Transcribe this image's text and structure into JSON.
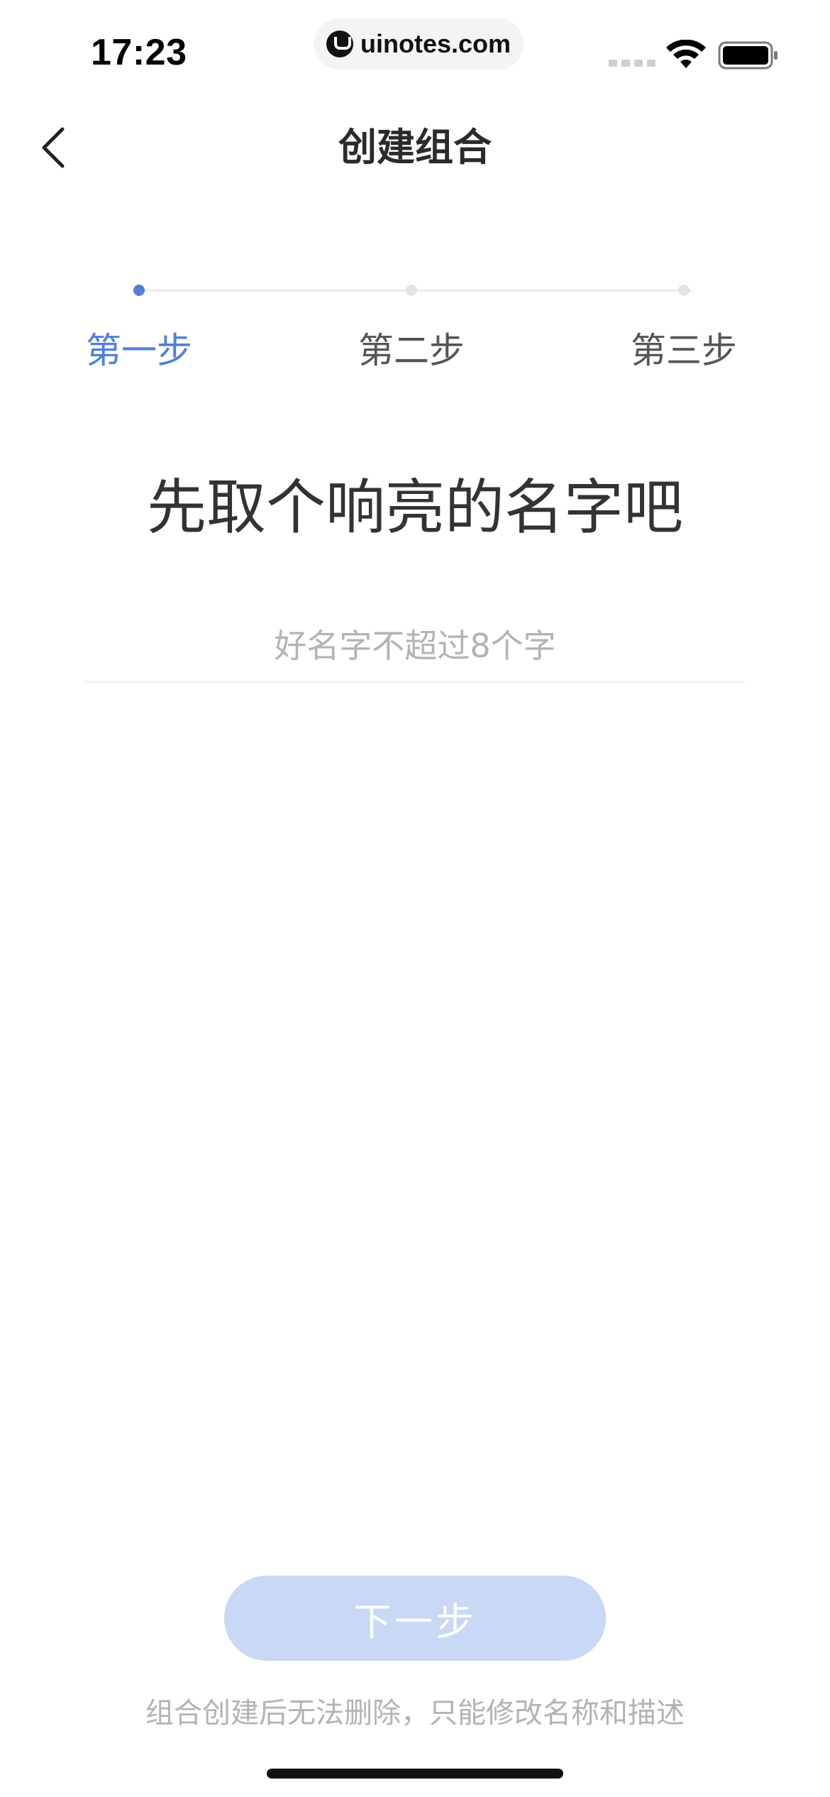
{
  "status_bar": {
    "time": "17:23",
    "watermark": "uinotes.com"
  },
  "header": {
    "title": "创建组合"
  },
  "steps": [
    {
      "label": "第一步",
      "active": true
    },
    {
      "label": "第二步",
      "active": false
    },
    {
      "label": "第三步",
      "active": false
    }
  ],
  "main": {
    "headline": "先取个响亮的名字吧",
    "name_input": {
      "placeholder": "好名字不超过8个字",
      "value": ""
    }
  },
  "footer": {
    "next_label": "下一步",
    "note": "组合创建后无法删除，只能修改名称和描述"
  },
  "colors": {
    "accent": "#4f7fd9",
    "button_disabled": "#c8d8f5"
  }
}
